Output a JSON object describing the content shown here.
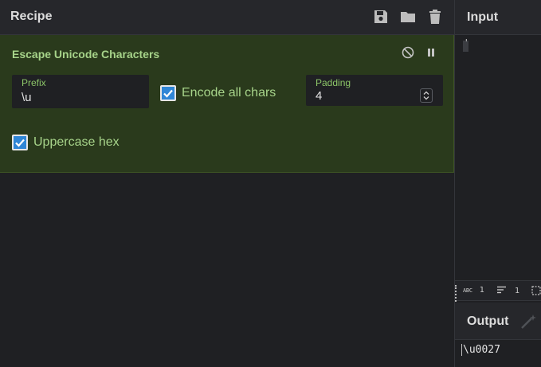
{
  "recipe": {
    "title": "Recipe",
    "icons": [
      "save-icon",
      "folder-icon",
      "trash-icon"
    ]
  },
  "operation": {
    "title": "Escape Unicode Characters",
    "icons": [
      "disable-icon",
      "pause-icon"
    ],
    "prefix": {
      "label": "Prefix",
      "value": "\\u"
    },
    "encode_all": {
      "label": "Encode all chars",
      "checked": true
    },
    "padding": {
      "label": "Padding",
      "value": "4"
    },
    "uppercase_hex": {
      "label": "Uppercase hex",
      "checked": true
    }
  },
  "input": {
    "title": "Input",
    "value": "'",
    "stats": {
      "chars_label": "ABC",
      "chars": "1",
      "lines": "1"
    }
  },
  "output": {
    "title": "Output",
    "value": "\\u0027",
    "icons": [
      "magic-wand-icon"
    ]
  },
  "colors": {
    "operation_bg": "#2a3a1c",
    "operation_text": "#a7d48a",
    "checkbox_accent": "#2f86d6",
    "panel_bg": "#1f2023"
  }
}
